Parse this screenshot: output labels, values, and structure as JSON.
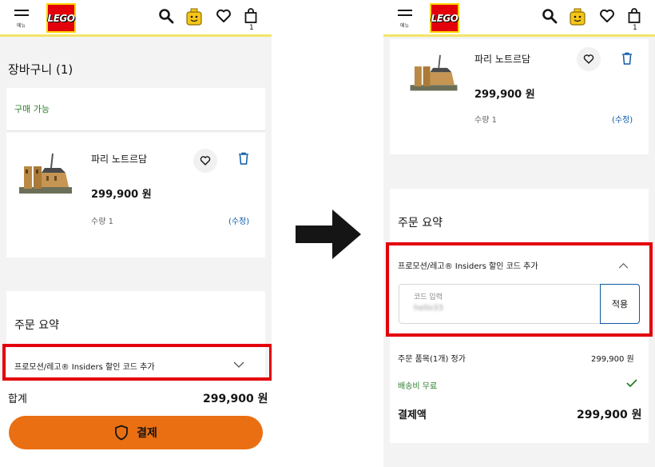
{
  "header": {
    "menu_label": "메뉴",
    "logo_text": "LEGO",
    "cart_count": "1"
  },
  "left": {
    "cart_title": "장바구니 (1)",
    "available_label": "구매 가능",
    "product": {
      "name": "파리 노트르담",
      "price": "299,900 원",
      "qty": "수량 1",
      "edit": "(수정)"
    },
    "summary_title": "주문 요약",
    "promo_label": "프로모션/레고® Insiders 할인 코드 추가",
    "total_label": "합계",
    "total_value": "299,900 원",
    "pay_button": "결제"
  },
  "right": {
    "product": {
      "name": "파리 노트르담",
      "price": "299,900 원",
      "qty": "수량 1",
      "edit": "(수정)"
    },
    "summary_title": "주문 요약",
    "promo_label": "프로모션/레고® Insiders 할인 코드 추가",
    "code_input_label": "코드 입력",
    "code_input_value": "hello33",
    "apply_button": "적용",
    "items_label": "주문 품목(1개) 정가",
    "items_value": "299,900 원",
    "shipping_label": "배송비 무료",
    "grand_label": "결제액",
    "grand_value": "299,900 원"
  },
  "colors": {
    "accent_yellow": "#f4e46b",
    "highlight_red": "#e3000b",
    "pay_orange": "#e96f12",
    "link_blue": "#0d5aa7",
    "green": "#2a7d2a"
  }
}
